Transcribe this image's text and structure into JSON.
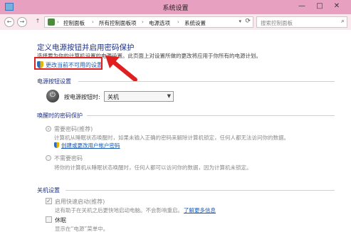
{
  "window": {
    "title": "系统设置",
    "controls": {
      "minimize": "—",
      "maximize": "□",
      "close": "✕"
    }
  },
  "addressbar": {
    "back": "←",
    "forward": "→",
    "up": "↑",
    "crumbs": [
      "控制面板",
      "所有控制面板项",
      "电源选项",
      "系统设置"
    ],
    "separator": "›",
    "search_placeholder": "搜索控制面板"
  },
  "page": {
    "heading": "定义电源按钮并启用密码保护",
    "intro": "选择要为你的计算机设置的电源设置。此页面上对设置所做的更改将应用于你所有的电源计划。",
    "change_link": "更改当前不可用的设置"
  },
  "power_button": {
    "section_title": "电源按钮设置",
    "label": "按电源按钮时:",
    "selected": "关机"
  },
  "wake_password": {
    "section_title": "唤醒时的密码保护",
    "option_require": "需要密码(推荐)",
    "option_require_desc": "计算机从睡眠状态唤醒时，如果未输入正确的密码来解除计算机锁定，任何人都无法访问你的数据。",
    "create_link": "创建或更改用户帐户密码",
    "option_none": "不需要密码",
    "option_none_desc": "将你的计算机从睡眠状态唤醒时，任何人都可以访问你的数据，因为计算机未锁定。"
  },
  "shutdown": {
    "section_title": "关机设置",
    "fast_startup": "启用快速启动(推荐)",
    "fast_startup_desc": "这有助于在关机之后更快地启动电脑。不会影响重启。",
    "learn_more": "了解更多信息",
    "hibernate": "休眠",
    "hibernate_desc": "显示在“电源”菜单中。"
  },
  "colors": {
    "titlebar": "#e8a0c0",
    "heading_blue": "#1e3287",
    "link_blue": "#1a5bb5",
    "highlight_red": "#e02020"
  }
}
